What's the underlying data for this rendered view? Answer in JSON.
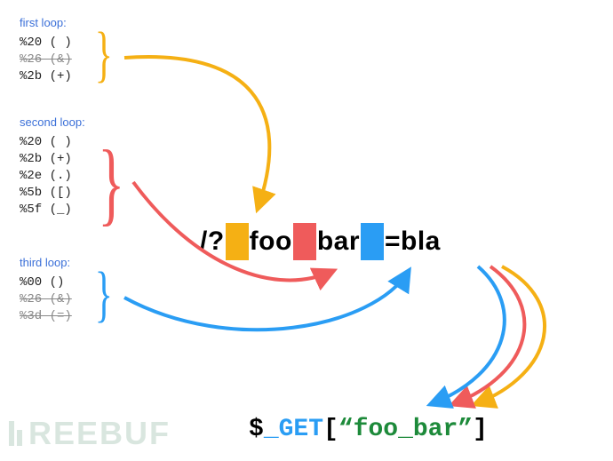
{
  "loops": [
    {
      "title": "first loop:",
      "items": [
        {
          "code": "%20 ( )",
          "struck": false
        },
        {
          "code": "%26 (&)",
          "struck": true
        },
        {
          "code": "%2b (+)",
          "struck": false
        }
      ],
      "color": "y"
    },
    {
      "title": "second loop:",
      "items": [
        {
          "code": "%20 ( )",
          "struck": false
        },
        {
          "code": "%2b (+)",
          "struck": false
        },
        {
          "code": "%2e (.)",
          "struck": false
        },
        {
          "code": "%5b ([)",
          "struck": false
        },
        {
          "code": "%5f (_)",
          "struck": false
        }
      ],
      "color": "r"
    },
    {
      "title": "third loop:",
      "items": [
        {
          "code": "%00 ()",
          "struck": false
        },
        {
          "code": "%26 (&)",
          "struck": true
        },
        {
          "code": "%3d (=)",
          "struck": true
        }
      ],
      "color": "b"
    }
  ],
  "query": {
    "prefix": "/?",
    "seg1": "foo",
    "seg2": "bar",
    "suffix": "=bla"
  },
  "get": {
    "dollar": "$",
    "underscore": "_",
    "name": "GET",
    "open": "[",
    "q1": "“",
    "key": "foo_bar",
    "q2": "”",
    "close": "]"
  },
  "watermark": "REEBUF"
}
